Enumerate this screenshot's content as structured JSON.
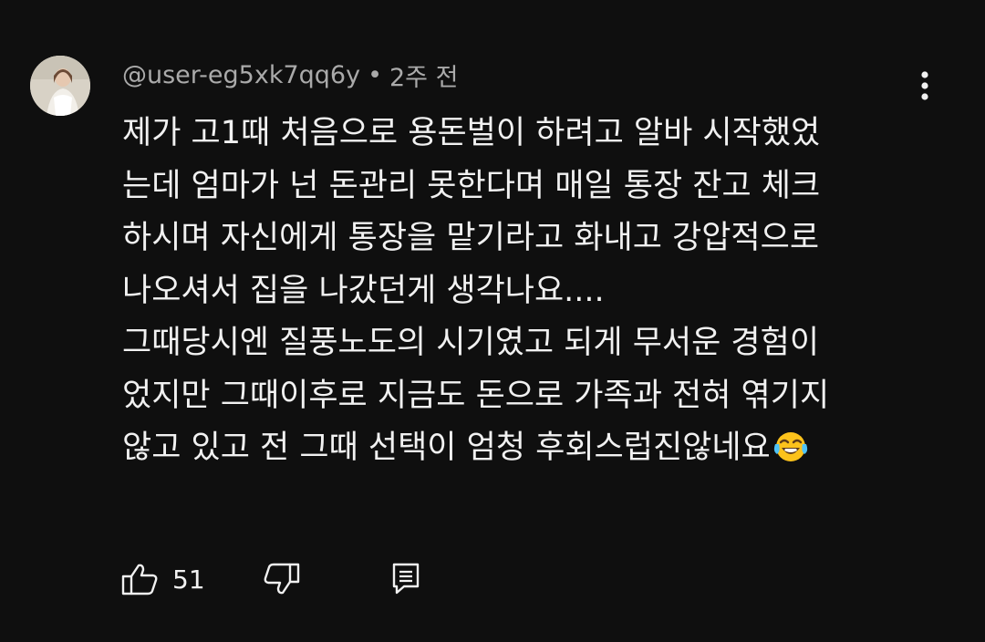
{
  "comment": {
    "author": "@user-eg5xk7qq6y",
    "separator": "•",
    "timestamp": "2주 전",
    "text_lines": [
      "제가 고1때 처음으로 용돈벌이 하려고 알바 시작했었",
      "는데 엄마가 넌 돈관리 못한다며 매일 통장 잔고 체크",
      "하시며 자신에게 통장을 맡기라고 화내고 강압적으로",
      "나오셔서 집을 나갔던게 생각나요....",
      "그때당시엔 질풍노도의 시기였고 되게 무서운 경험이",
      "었지만 그때이후로 지금도 돈으로 가족과 전혀 엮기지",
      "않고 있고 전 그때 선택이 엄청 후회스럽진않네요"
    ],
    "emoji": "face-with-tears-of-joy",
    "like_count": "51"
  },
  "icons": {
    "more": "more-vert-icon",
    "like": "thumb-up-icon",
    "dislike": "thumb-down-icon",
    "reply": "reply-comment-icon"
  },
  "colors": {
    "background": "#0f0f0f",
    "text_primary": "#f1f1f1",
    "text_secondary": "#aaaaaa"
  }
}
